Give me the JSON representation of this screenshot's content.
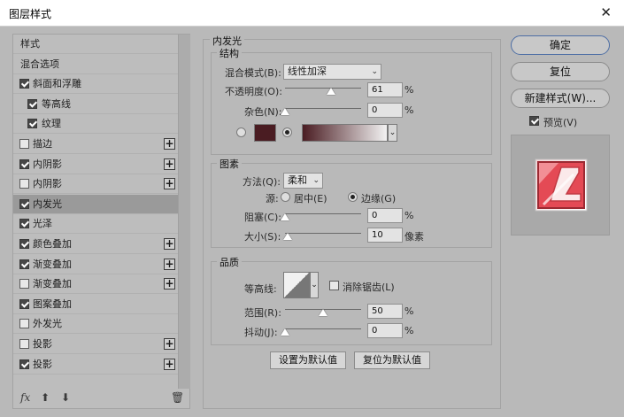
{
  "window": {
    "title": "图层样式",
    "close_glyph": "✕"
  },
  "left_panel": {
    "items": [
      {
        "label": "样式",
        "checkbox": null,
        "plus": false
      },
      {
        "label": "混合选项",
        "checkbox": null,
        "plus": false
      },
      {
        "label": "斜面和浮雕",
        "checkbox": true,
        "plus": false
      },
      {
        "label": "等高线",
        "checkbox": true,
        "plus": false,
        "indent": true
      },
      {
        "label": "纹理",
        "checkbox": true,
        "plus": false,
        "indent": true
      },
      {
        "label": "描边",
        "checkbox": false,
        "plus": true
      },
      {
        "label": "内阴影",
        "checkbox": true,
        "plus": true
      },
      {
        "label": "内阴影",
        "checkbox": false,
        "plus": true
      },
      {
        "label": "内发光",
        "checkbox": true,
        "plus": false,
        "selected": true
      },
      {
        "label": "光泽",
        "checkbox": true,
        "plus": false
      },
      {
        "label": "颜色叠加",
        "checkbox": true,
        "plus": true
      },
      {
        "label": "渐变叠加",
        "checkbox": true,
        "plus": true
      },
      {
        "label": "渐变叠加",
        "checkbox": false,
        "plus": true
      },
      {
        "label": "图案叠加",
        "checkbox": true,
        "plus": false
      },
      {
        "label": "外发光",
        "checkbox": false,
        "plus": false
      },
      {
        "label": "投影",
        "checkbox": false,
        "plus": true
      },
      {
        "label": "投影",
        "checkbox": true,
        "plus": true
      }
    ],
    "footer": {
      "fx": "fx",
      "up": "⬆",
      "down": "⬇",
      "trash": "🗑"
    }
  },
  "inner_glow": {
    "section_title": "内发光",
    "structure": {
      "title": "结构",
      "blend_mode_label": "混合模式(B):",
      "blend_mode_value": "线性加深",
      "opacity_label": "不透明度(O):",
      "opacity_value": "61",
      "opacity_fraction": 0.61,
      "noise_label": "杂色(N):",
      "noise_value": "0",
      "noise_fraction": 0.0,
      "unit": "%",
      "color_swatch": "#4a1c22"
    },
    "elements": {
      "title": "图素",
      "method_label": "方法(Q):",
      "method_value": "柔和",
      "source_label": "源:",
      "source_center": "居中(E)",
      "source_edge": "边缘(G)",
      "choke_label": "阻塞(C):",
      "choke_value": "0",
      "choke_fraction": 0.0,
      "size_label": "大小(S):",
      "size_value": "10",
      "size_fraction": 0.04,
      "size_unit": "像素"
    },
    "quality": {
      "title": "品质",
      "contour_label": "等高线:",
      "anti_alias_label": "消除锯齿(L)",
      "range_label": "范围(R):",
      "range_value": "50",
      "range_fraction": 0.5,
      "jitter_label": "抖动(J):",
      "jitter_value": "0",
      "jitter_fraction": 0.0
    },
    "buttons": {
      "make_default": "设置为默认值",
      "reset_default": "复位为默认值"
    }
  },
  "right": {
    "ok": "确定",
    "reset": "复位",
    "new_style": "新建样式(W)...",
    "preview_label": "预览(V)",
    "preview_checked": true
  }
}
